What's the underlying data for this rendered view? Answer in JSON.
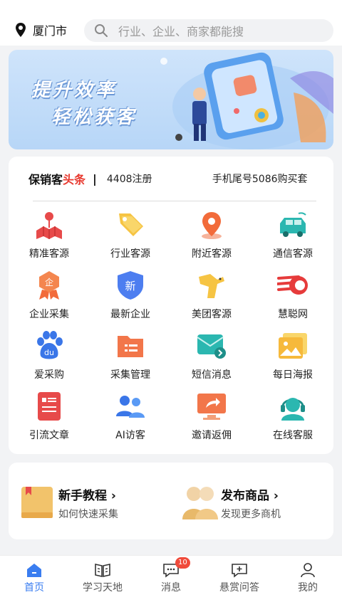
{
  "location": {
    "city": "厦门市"
  },
  "search": {
    "placeholder": "行业、企业、商家都能搜"
  },
  "banner": {
    "line1": "提升效率",
    "line2": "轻松获客"
  },
  "news": {
    "brand_prefix": "保销客",
    "brand_highlight": "头条",
    "separator": "|",
    "items": [
      "4408注册",
      "手机尾号5086购买套"
    ]
  },
  "grid": [
    {
      "label": "精准客源",
      "icon": "map-icon"
    },
    {
      "label": "行业客源",
      "icon": "tag-icon"
    },
    {
      "label": "附近客源",
      "icon": "location-pin-icon"
    },
    {
      "label": "通信客源",
      "icon": "van-icon"
    },
    {
      "label": "企业采集",
      "icon": "enterprise-badge-icon"
    },
    {
      "label": "最新企业",
      "icon": "new-shield-icon"
    },
    {
      "label": "美团客源",
      "icon": "kangaroo-icon"
    },
    {
      "label": "慧聪网",
      "icon": "huicong-icon"
    },
    {
      "label": "爱采购",
      "icon": "paw-icon"
    },
    {
      "label": "采集管理",
      "icon": "folder-icon"
    },
    {
      "label": "短信消息",
      "icon": "message-icon"
    },
    {
      "label": "每日海报",
      "icon": "poster-icon"
    },
    {
      "label": "引流文章",
      "icon": "article-icon"
    },
    {
      "label": "AI访客",
      "icon": "visitors-icon"
    },
    {
      "label": "邀请返佣",
      "icon": "share-screen-icon"
    },
    {
      "label": "在线客服",
      "icon": "headset-icon"
    }
  ],
  "features": [
    {
      "title": "新手教程",
      "subtitle": "如何快速采集",
      "icon": "book-icon"
    },
    {
      "title": "发布商品",
      "subtitle": "发现更多商机",
      "icon": "people-icon"
    }
  ],
  "tabs": [
    {
      "label": "首页",
      "icon": "home-icon",
      "active": true
    },
    {
      "label": "学习天地",
      "icon": "open-book-icon",
      "active": false
    },
    {
      "label": "消息",
      "icon": "chat-icon",
      "active": false,
      "badge": "10"
    },
    {
      "label": "悬赏问答",
      "icon": "question-chat-icon",
      "active": false
    },
    {
      "label": "我的",
      "icon": "user-icon",
      "active": false
    }
  ],
  "colors": {
    "accent": "#3a7df0",
    "highlight": "#e8392f",
    "badge": "#f04a3a"
  }
}
